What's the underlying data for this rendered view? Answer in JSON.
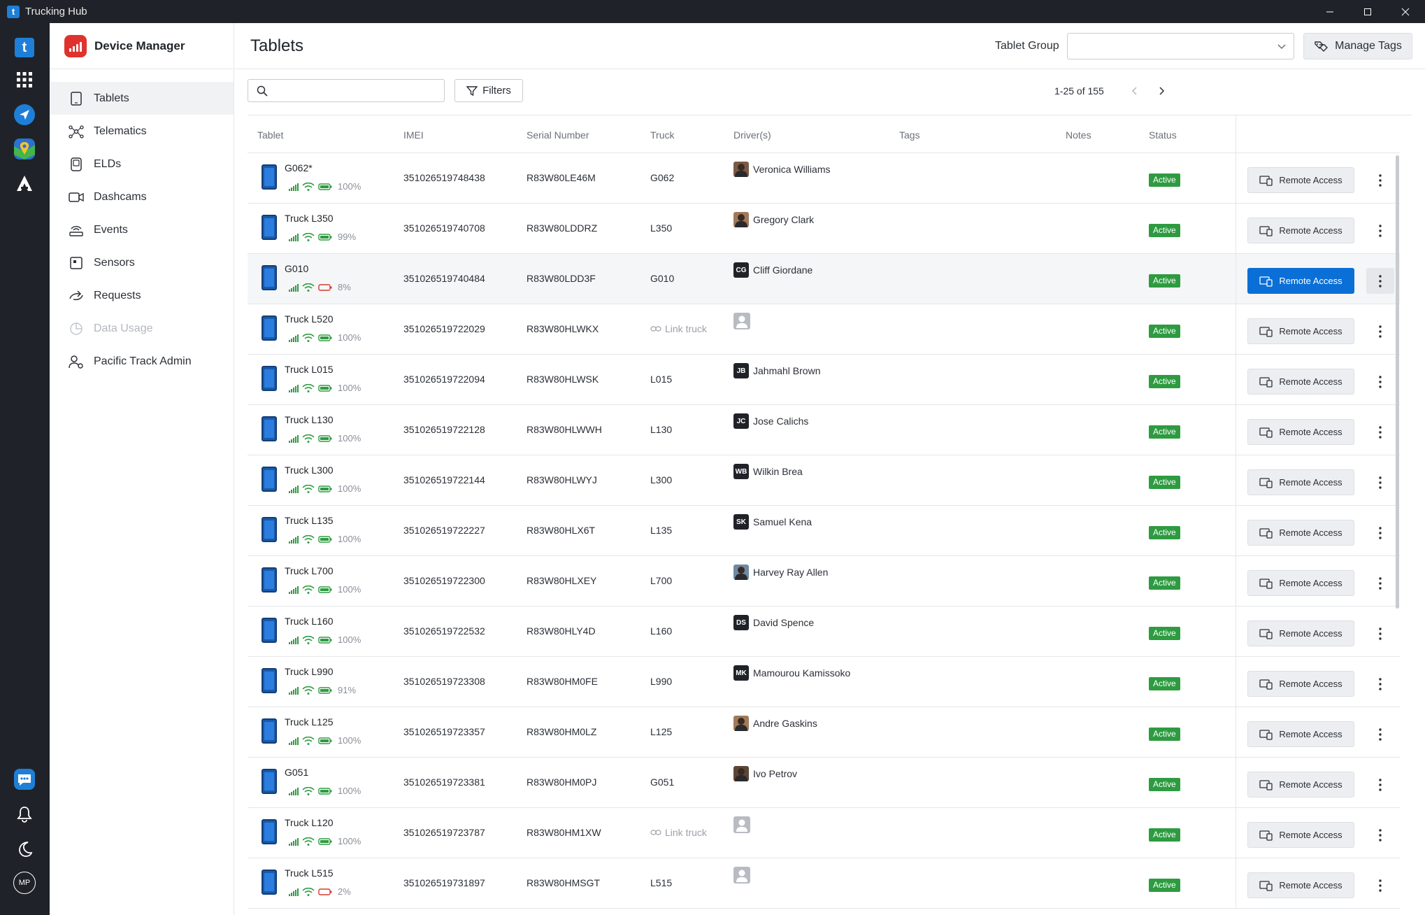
{
  "window": {
    "title": "Trucking Hub"
  },
  "sidebar": {
    "app_title": "Device Manager",
    "items": [
      {
        "label": "Tablets",
        "icon": "tablet-icon"
      },
      {
        "label": "Telematics",
        "icon": "telematics-icon"
      },
      {
        "label": "ELDs",
        "icon": "eld-icon"
      },
      {
        "label": "Dashcams",
        "icon": "dashcam-icon"
      },
      {
        "label": "Events",
        "icon": "events-icon"
      },
      {
        "label": "Sensors",
        "icon": "sensor-icon"
      },
      {
        "label": "Requests",
        "icon": "requests-icon"
      },
      {
        "label": "Data Usage",
        "icon": "data-usage-icon"
      },
      {
        "label": "Pacific Track Admin",
        "icon": "admin-icon"
      }
    ]
  },
  "rail": {
    "user_initials": "MP"
  },
  "header": {
    "title": "Tablets",
    "tablet_group_label": "Tablet Group",
    "tablet_group_value": "",
    "manage_tags_label": "Manage Tags"
  },
  "toolbar": {
    "search_placeholder": "",
    "filters_label": "Filters",
    "pagination": "1-25 of 155"
  },
  "table": {
    "columns": [
      "Tablet",
      "IMEI",
      "Serial Number",
      "Truck",
      "Driver(s)",
      "Tags",
      "Notes",
      "Status"
    ],
    "action_label": "Remote Access",
    "link_truck_label": "Link truck",
    "rows": [
      {
        "name": "G062*",
        "battery": "100%",
        "battery_low": false,
        "imei": "351026519748438",
        "serial": "R83W80LE46M",
        "truck": "G062",
        "driver": "Veronica Williams",
        "initials": "",
        "status": "Active"
      },
      {
        "name": "Truck L350",
        "battery": "99%",
        "battery_low": false,
        "imei": "351026519740708",
        "serial": "R83W80LDDRZ",
        "truck": "L350",
        "driver": "Gregory Clark",
        "initials": "",
        "status": "Active"
      },
      {
        "name": "G010",
        "battery": "8%",
        "battery_low": true,
        "imei": "351026519740484",
        "serial": "R83W80LDD3F",
        "truck": "G010",
        "driver": "Cliff Giordane",
        "initials": "CG",
        "status": "Active"
      },
      {
        "name": "Truck L520",
        "battery": "100%",
        "battery_low": false,
        "imei": "351026519722029",
        "serial": "R83W80HLWKX",
        "truck": "",
        "driver": "",
        "initials": "",
        "status": "Active"
      },
      {
        "name": "Truck L015",
        "battery": "100%",
        "battery_low": false,
        "imei": "351026519722094",
        "serial": "R83W80HLWSK",
        "truck": "L015",
        "driver": "Jahmahl Brown",
        "initials": "JB",
        "status": "Active"
      },
      {
        "name": "Truck L130",
        "battery": "100%",
        "battery_low": false,
        "imei": "351026519722128",
        "serial": "R83W80HLWWH",
        "truck": "L130",
        "driver": "Jose Calichs",
        "initials": "JC",
        "status": "Active"
      },
      {
        "name": "Truck L300",
        "battery": "100%",
        "battery_low": false,
        "imei": "351026519722144",
        "serial": "R83W80HLWYJ",
        "truck": "L300",
        "driver": "Wilkin Brea",
        "initials": "WB",
        "status": "Active"
      },
      {
        "name": "Truck L135",
        "battery": "100%",
        "battery_low": false,
        "imei": "351026519722227",
        "serial": "R83W80HLX6T",
        "truck": "L135",
        "driver": "Samuel Kena",
        "initials": "SK",
        "status": "Active"
      },
      {
        "name": "Truck L700",
        "battery": "100%",
        "battery_low": false,
        "imei": "351026519722300",
        "serial": "R83W80HLXEY",
        "truck": "L700",
        "driver": "Harvey Ray Allen",
        "initials": "",
        "status": "Active"
      },
      {
        "name": "Truck L160",
        "battery": "100%",
        "battery_low": false,
        "imei": "351026519722532",
        "serial": "R83W80HLY4D",
        "truck": "L160",
        "driver": "David Spence",
        "initials": "DS",
        "status": "Active"
      },
      {
        "name": "Truck L990",
        "battery": "91%",
        "battery_low": false,
        "imei": "351026519723308",
        "serial": "R83W80HM0FE",
        "truck": "L990",
        "driver": "Mamourou Kamissoko",
        "initials": "MK",
        "status": "Active"
      },
      {
        "name": "Truck L125",
        "battery": "100%",
        "battery_low": false,
        "imei": "351026519723357",
        "serial": "R83W80HM0LZ",
        "truck": "L125",
        "driver": "Andre Gaskins",
        "initials": "",
        "status": "Active"
      },
      {
        "name": "G051",
        "battery": "100%",
        "battery_low": false,
        "imei": "351026519723381",
        "serial": "R83W80HM0PJ",
        "truck": "G051",
        "driver": "Ivo Petrov",
        "initials": "",
        "status": "Active"
      },
      {
        "name": "Truck L120",
        "battery": "100%",
        "battery_low": false,
        "imei": "351026519723787",
        "serial": "R83W80HM1XW",
        "truck": "",
        "driver": "",
        "initials": "",
        "status": "Active"
      },
      {
        "name": "Truck L515",
        "battery": "2%",
        "battery_low": true,
        "imei": "351026519731897",
        "serial": "R83W80HMSGT",
        "truck": "L515",
        "driver": "",
        "initials": "",
        "status": "Active"
      }
    ]
  },
  "colors": {
    "titlebar": "#1f2329",
    "accent": "#0a6fd6",
    "status_active": "#2e9b41",
    "battery_ok": "#2e9b41",
    "battery_low": "#d83a2e",
    "device_manager_logo": "#e0322d"
  }
}
